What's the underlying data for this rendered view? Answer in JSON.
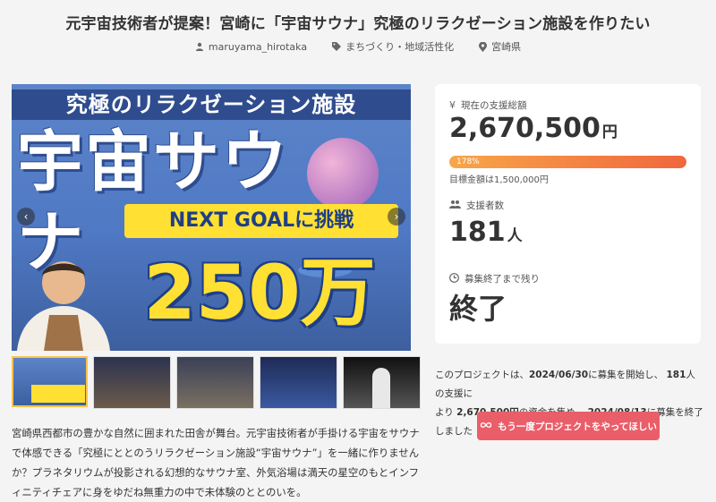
{
  "project": {
    "title": "元宇宙技術者が提案！宮崎に「宇宙サウナ」究極のリラクゼーション施設を作りたい",
    "author": "maruyama_hirotaka",
    "category": "まちづくり・地域活性化",
    "location": "宮崎県"
  },
  "hero": {
    "band_text": "究極のリラクゼーション施設",
    "main_text": "宇宙サウナ",
    "goal_text": "NEXT GOALに挑戦",
    "amount_text": "250万円"
  },
  "stats": {
    "raised_label": "現在の支援総額",
    "raised_value": "2,670,500",
    "raised_unit": "円",
    "percent_text": "178%",
    "percent_value": 178,
    "goal_text": "目標金額は1,500,000円",
    "backers_label": "支援者数",
    "backers_value": "181",
    "backers_unit": "人",
    "remaining_label": "募集終了まで残り",
    "remaining_value": "終了"
  },
  "summary": {
    "p1": "このプロジェクトは、",
    "start_date": "2024/06/30",
    "p2": "に募集を開始し、",
    "backers": "181",
    "p3": "人の支援に",
    "p4": "より",
    "amount": "2,670,500円",
    "p5": "の資金を集め、",
    "end_date": "2024/08/13",
    "p6": "に募集を終了しました"
  },
  "cta": {
    "label": "もう一度プロジェクトをやってほしい"
  },
  "description": "宮崎県西都市の豊かな自然に囲まれた田舎が舞台。元宇宙技術者が手掛ける宇宙をサウナで体感できる「究極にととのうリラクゼーション施設“宇宙サウナ”」を一緒に作りませんか？プラネタリウムが投影される幻想的なサウナ室、外気浴場は満天の星空のもとインフィニティチェアに身をゆだね無重力の中で未体験のととのいを。",
  "colors": {
    "accent": "#ea5e6a",
    "progress_start": "#f7a64a",
    "progress_end": "#f0673e",
    "hero_blue": "#4f79c4",
    "yellow": "#ffe033"
  },
  "icons": [
    "user-icon",
    "tag-icon",
    "location-pin-icon",
    "yen-icon",
    "users-icon",
    "clock-icon",
    "infinity-icon",
    "chevron-left-icon",
    "chevron-right-icon"
  ]
}
